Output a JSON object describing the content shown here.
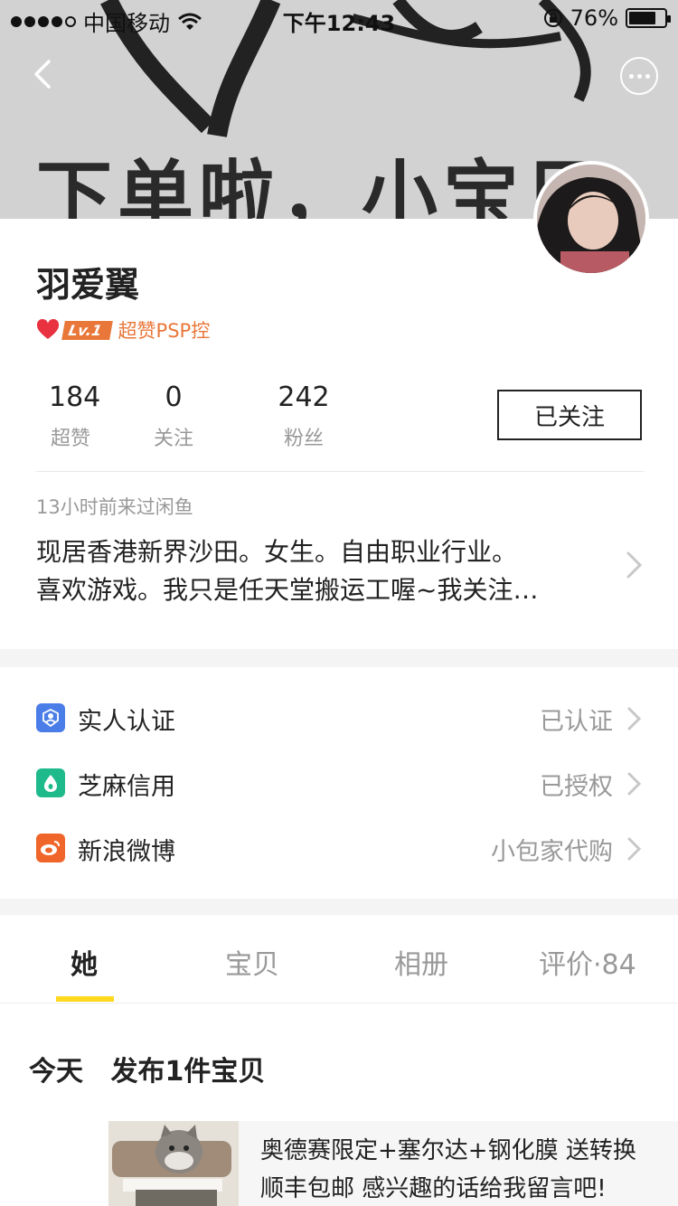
{
  "status_bar": {
    "carrier": "中国移动",
    "time": "下午12:43",
    "battery_percent": "76%",
    "battery_level": 0.76,
    "signal_bars": 4
  },
  "banner": {
    "text": "下单啦，小宝贝"
  },
  "icons": {
    "back": "back-arrow-icon",
    "more": "more-options-icon",
    "heart": "heart-icon",
    "chevron": "chevron-right-icon",
    "real_name": "person-badge-icon",
    "zhima": "sesame-credit-icon",
    "weibo": "weibo-icon"
  },
  "profile": {
    "username": "羽爱翼",
    "level_badge": "Lv.1",
    "level_title": "超赞PSP控",
    "stats": [
      {
        "value": "184",
        "label": "超赞"
      },
      {
        "value": "0",
        "label": "关注"
      },
      {
        "value": "242",
        "label": "粉丝"
      }
    ],
    "follow_button": "已关注",
    "last_seen": "13小时前来过闲鱼",
    "bio_line1": "现居香港新界沙田。女生。自由职业行业。",
    "bio_line2": "喜欢游戏。我只是任天堂搬运工喔~我关注…"
  },
  "verification": [
    {
      "label": "实人认证",
      "value": "已认证",
      "color": "#4a7de8"
    },
    {
      "label": "芝麻信用",
      "value": "已授权",
      "color": "#1fba8c"
    },
    {
      "label": "新浪微博",
      "value": "小包家代购",
      "color": "#f0652a"
    }
  ],
  "tabs": [
    {
      "label": "她",
      "active": true
    },
    {
      "label": "宝贝",
      "active": false
    },
    {
      "label": "相册",
      "active": false
    },
    {
      "label": "评价·84",
      "active": false
    }
  ],
  "feed": {
    "day": "今天",
    "summary": "发布1件宝贝",
    "item_line1": "奥德赛限定+塞尔达+钢化膜 送转换",
    "item_line2": "顺丰包邮 感兴趣的话给我留言吧!"
  },
  "colors": {
    "accent_yellow": "#ffd91f",
    "level_orange": "#e9773a",
    "muted_text": "#999999"
  }
}
